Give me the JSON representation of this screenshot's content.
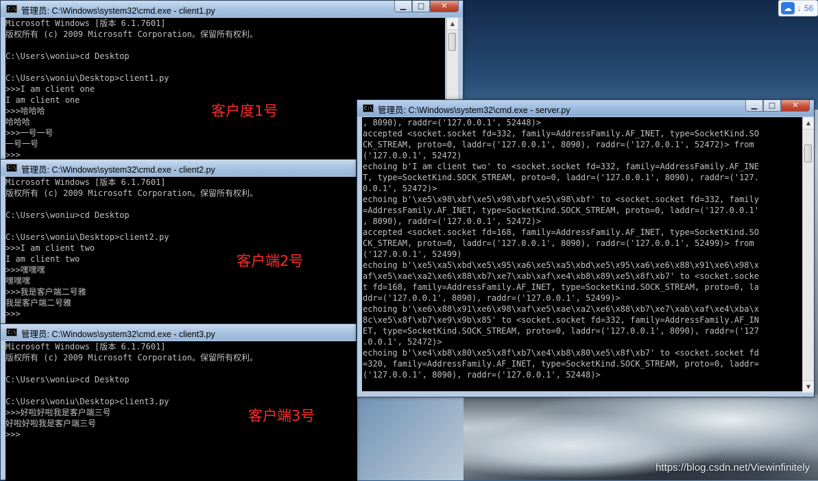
{
  "desktop": {
    "watermark": "https://blog.csdn.net/Viewinfinitely",
    "tray_badge": "56"
  },
  "windows": {
    "client1": {
      "title": "管理员: C:\\Windows\\system32\\cmd.exe - client1.py",
      "lines": [
        "Microsoft Windows [版本 6.1.7601]",
        "版权所有 (c) 2009 Microsoft Corporation。保留所有权利。",
        "",
        "C:\\Users\\woniu>cd Desktop",
        "",
        "C:\\Users\\woniu\\Desktop>client1.py",
        ">>>I am client one",
        "I am client one",
        ">>>哈哈哈",
        "哈哈哈",
        ">>>一号一号",
        "一号一号",
        ">>>"
      ],
      "annotation": "客户度1号"
    },
    "client2": {
      "title": "管理员: C:\\Windows\\system32\\cmd.exe - client2.py",
      "lines": [
        "Microsoft Windows [版本 6.1.7601]",
        "版权所有 (c) 2009 Microsoft Corporation。保留所有权利。",
        "",
        "C:\\Users\\woniu>cd Desktop",
        "",
        "C:\\Users\\woniu\\Desktop>client2.py",
        ">>>I am client two",
        "I am client two",
        ">>>嘿嘿嘿",
        "嘿嘿嘿",
        ">>>我是客户端二号雅",
        "我是客户端二号雅",
        ">>>"
      ],
      "annotation": "客户端2号"
    },
    "client3": {
      "title": "管理员: C:\\Windows\\system32\\cmd.exe - client3.py",
      "lines": [
        "Microsoft Windows [版本 6.1.7601]",
        "版权所有 (c) 2009 Microsoft Corporation。保留所有权利。",
        "",
        "C:\\Users\\woniu>cd Desktop",
        "",
        "C:\\Users\\woniu\\Desktop>client3.py",
        ">>>好啦好啦我是客户端三号",
        "好啦好啦我是客户端三号",
        ">>>"
      ],
      "annotation": "客户端3号"
    },
    "server": {
      "title": "管理员: C:\\Windows\\system32\\cmd.exe - server.py",
      "lines": [
        ", 8090), raddr=('127.0.0.1', 52448)>",
        "accepted <socket.socket fd=332, family=AddressFamily.AF_INET, type=SocketKind.SO",
        "CK_STREAM, proto=0, laddr=('127.0.0.1', 8090), raddr=('127.0.0.1', 52472)> from",
        "('127.0.0.1', 52472)",
        "echoing b'I am client two' to <socket.socket fd=332, family=AddressFamily.AF_INE",
        "T, type=SocketKind.SOCK_STREAM, proto=0, laddr=('127.0.0.1', 8090), raddr=('127.",
        "0.0.1', 52472)>",
        "echoing b'\\xe5\\x98\\xbf\\xe5\\x98\\xbf\\xe5\\x98\\xbf' to <socket.socket fd=332, family",
        "=AddressFamily.AF_INET, type=SocketKind.SOCK_STREAM, proto=0, laddr=('127.0.0.1'",
        ", 8090), raddr=('127.0.0.1', 52472)>",
        "accepted <socket.socket fd=168, family=AddressFamily.AF_INET, type=SocketKind.SO",
        "CK_STREAM, proto=0, laddr=('127.0.0.1', 8090), raddr=('127.0.0.1', 52499)> from",
        "('127.0.0.1', 52499)",
        "echoing b'\\xe5\\xa5\\xbd\\xe5\\x95\\xa6\\xe5\\xa5\\xbd\\xe5\\x95\\xa6\\xe6\\x88\\x91\\xe6\\x98\\x",
        "af\\xe5\\xae\\xa2\\xe6\\x88\\xb7\\xe7\\xab\\xaf\\xe4\\xb8\\x89\\xe5\\x8f\\xb7' to <socket.socke",
        "t fd=168, family=AddressFamily.AF_INET, type=SocketKind.SOCK_STREAM, proto=0, la",
        "ddr=('127.0.0.1', 8090), raddr=('127.0.0.1', 52499)>",
        "echoing b'\\xe6\\x88\\x91\\xe6\\x98\\xaf\\xe5\\xae\\xa2\\xe6\\x88\\xb7\\xe7\\xab\\xaf\\xe4\\xba\\x",
        "8c\\xe5\\x8f\\xb7\\xe9\\x9b\\x85' to <socket.socket fd=332, family=AddressFamily.AF_IN",
        "ET, type=SocketKind.SOCK_STREAM, proto=0, laddr=('127.0.0.1', 8090), raddr=('127",
        ".0.0.1', 52472)>",
        "echoing b'\\xe4\\xb8\\x80\\xe5\\x8f\\xb7\\xe4\\xb8\\x80\\xe5\\x8f\\xb7' to <socket.socket fd",
        "=320, family=AddressFamily.AF_INET, type=SocketKind.SOCK_STREAM, proto=0, laddr=",
        "('127.0.0.1', 8090), raddr=('127.0.0.1', 52448)>"
      ]
    }
  }
}
